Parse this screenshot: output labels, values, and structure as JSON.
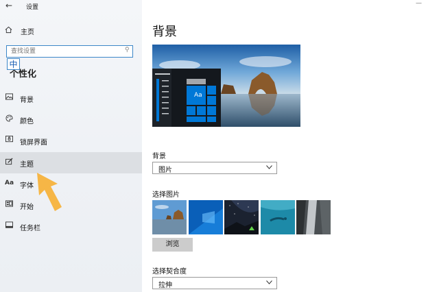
{
  "window": {
    "title": "设置"
  },
  "sidebar": {
    "home_label": "主页",
    "search": {
      "placeholder": "查找设置",
      "value": ""
    },
    "ime_indicator": "中",
    "section_title": "个性化",
    "items": [
      {
        "label": "背景",
        "icon": "picture-icon",
        "active": false
      },
      {
        "label": "颜色",
        "icon": "palette-icon",
        "active": false
      },
      {
        "label": "锁屏界面",
        "icon": "lock-screen-icon",
        "active": false
      },
      {
        "label": "主题",
        "icon": "theme-brush-icon",
        "active": true
      },
      {
        "label": "字体",
        "icon": "font-icon",
        "active": false
      },
      {
        "label": "开始",
        "icon": "start-icon",
        "active": false
      },
      {
        "label": "任务栏",
        "icon": "taskbar-icon",
        "active": false
      }
    ]
  },
  "main": {
    "page_title": "背景",
    "preview_tile_text": "Aa",
    "background_label": "背景",
    "background_dropdown": {
      "value": "图片"
    },
    "choose_picture_label": "选择图片",
    "thumbnails": [
      "coastal-rock-arch",
      "windows-blue",
      "night-sky-tent",
      "underwater-swimmer",
      "waterfall-cliff"
    ],
    "browse_label": "浏览",
    "fit_label": "选择契合度",
    "fit_dropdown": {
      "value": "拉伸"
    }
  },
  "colors": {
    "accent": "#0078d7",
    "active_nav_bg": "#dcdfe3",
    "arrow": "#f5b23c"
  }
}
